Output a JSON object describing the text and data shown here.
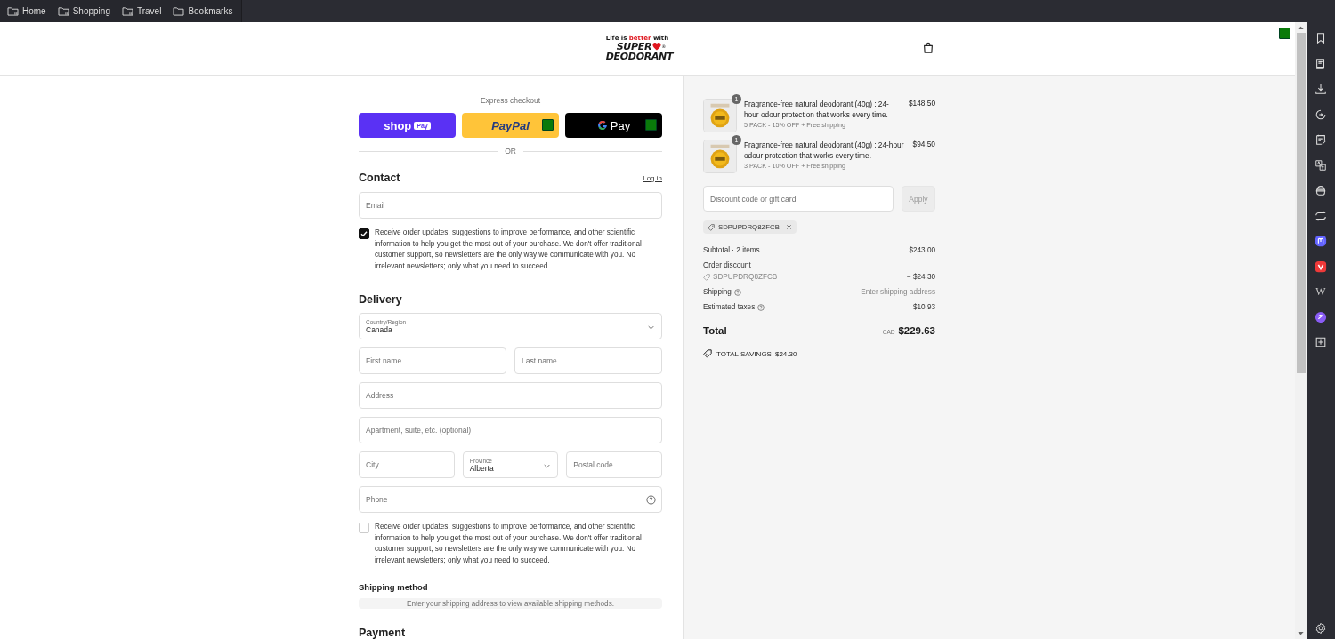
{
  "bookmarks_bar": {
    "items": [
      {
        "label": "Home",
        "kind": "folder-grid"
      },
      {
        "label": "Shopping",
        "kind": "folder-grid"
      },
      {
        "label": "Travel",
        "kind": "folder-grid"
      },
      {
        "label": "Bookmarks",
        "kind": "folder"
      }
    ]
  },
  "header": {
    "logo": {
      "tagline": [
        {
          "text": "Life is ",
          "accent": false
        },
        {
          "text": "better",
          "accent": true
        },
        {
          "text": " with",
          "accent": false
        }
      ],
      "line_1": "SUPER",
      "line_2": "DEODORANT",
      "registered": "®"
    }
  },
  "web_panel_label": "W",
  "express": {
    "title": "Express checkout",
    "buttons": [
      {
        "kind": "shop",
        "label": "shop",
        "badge": "Pay"
      },
      {
        "kind": "paypal",
        "label": "PayPal"
      },
      {
        "kind": "gpay",
        "label": "Pay"
      }
    ],
    "separator": "OR"
  },
  "contact": {
    "heading": "Contact",
    "login": "Log in",
    "email": {
      "placeholder": "Email"
    },
    "newsletter": {
      "checked": true,
      "text": "Receive order updates, suggestions to improve performance, and other scientific information to help you get the most out of your purchase. We don't offer traditional customer support, so newsletters are the only way we communicate with you. No irrelevant newsletters; only what you need to succeed."
    }
  },
  "delivery": {
    "heading": "Delivery",
    "rows": [
      [
        {
          "kind": "select",
          "label": "Country/Region",
          "value": "Canada"
        }
      ],
      [
        {
          "kind": "text",
          "placeholder": "First name"
        },
        {
          "kind": "text",
          "placeholder": "Last name"
        }
      ],
      [
        {
          "kind": "text",
          "placeholder": "Address"
        }
      ],
      [
        {
          "kind": "text",
          "placeholder": "Apartment, suite, etc. (optional)"
        }
      ],
      [
        {
          "kind": "text",
          "placeholder": "City"
        },
        {
          "kind": "select",
          "label": "Province",
          "value": "Alberta"
        },
        {
          "kind": "text",
          "placeholder": "Postal code"
        }
      ],
      [
        {
          "kind": "phone",
          "placeholder": "Phone"
        }
      ]
    ],
    "sms": {
      "checked": false,
      "text": "Receive order updates, suggestions to improve performance, and other scientific information to help you get the most out of your purchase. We don't offer traditional customer support, so newsletters are the only way we communicate with you. No irrelevant newsletters; only what you need to succeed."
    }
  },
  "shipping_method": {
    "heading": "Shipping method",
    "notice": "Enter your shipping address to view available shipping methods."
  },
  "payment": {
    "heading": "Payment"
  },
  "order": {
    "items": [
      {
        "quantity": "1",
        "title": "Fragrance-free natural deodorant (40g) : 24-hour odour protection that works every time.",
        "variant": "5 PACK - 15% OFF + Free shipping",
        "price": "$148.50"
      },
      {
        "quantity": "1",
        "title": "Fragrance-free natural deodorant (40g) : 24-hour odour protection that works every time.",
        "variant": "3 PACK - 10% OFF + Free shipping",
        "price": "$94.50"
      }
    ],
    "discount": {
      "placeholder": "Discount code or gift card",
      "apply": "Apply",
      "disabled": true
    },
    "applied_code": "SDPUPDRQ8ZFCB",
    "summary": [
      {
        "kind": "row",
        "label": "Subtotal · 2 items",
        "value": "$243.00"
      },
      {
        "kind": "discount",
        "label": "Order discount",
        "code": "SDPUPDRQ8ZFCB",
        "value": "− $24.30"
      },
      {
        "kind": "help",
        "label": "Shipping",
        "value": "Enter shipping address",
        "muted": true
      },
      {
        "kind": "help",
        "label": "Estimated taxes",
        "value": "$10.93",
        "muted": false
      }
    ],
    "total": {
      "label": "Total",
      "currency": "CAD",
      "value": "$229.63"
    },
    "savings": {
      "label": "TOTAL SAVINGS",
      "value": "$24.30"
    }
  }
}
